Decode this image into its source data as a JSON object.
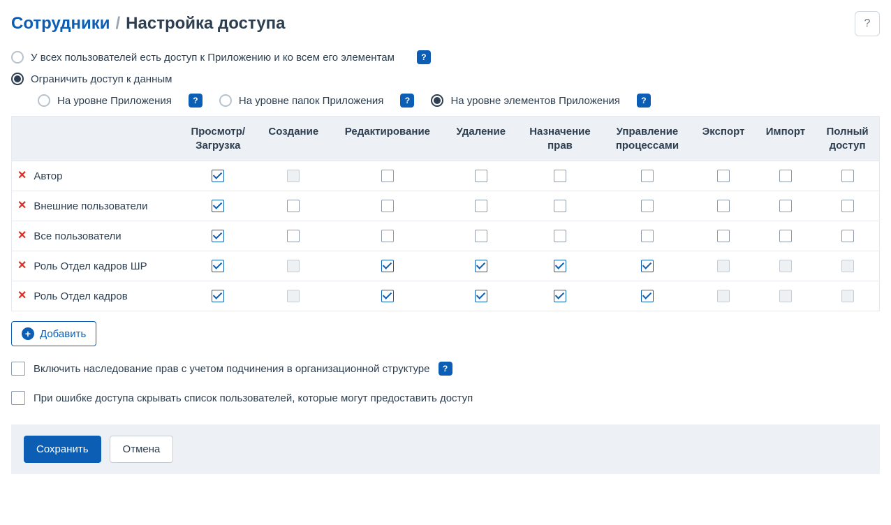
{
  "breadcrumb": {
    "parent": "Сотрудники",
    "separator": "/",
    "current": "Настройка доступа"
  },
  "help_glyph": "?",
  "access_mode": {
    "all_users": {
      "label": "У всех пользователей есть доступ к Приложению и ко всем его элементам",
      "selected": false
    },
    "restrict": {
      "label": "Ограничить доступ к данным",
      "selected": true
    }
  },
  "restrict_level": {
    "app": {
      "label": "На уровне Приложения",
      "selected": false
    },
    "folders": {
      "label": "На уровне папок Приложения",
      "selected": false
    },
    "elements": {
      "label": "На уровне элементов Приложения",
      "selected": true
    }
  },
  "columns": [
    "Просмотр/",
    "Загрузка",
    "Создание",
    "Редактирование",
    "Удаление",
    "Назначение",
    "прав",
    "Управление",
    "процессами",
    "Экспорт",
    "Импорт",
    "Полный",
    "доступ"
  ],
  "col_headers": {
    "view": {
      "l1": "Просмотр/",
      "l2": "Загрузка"
    },
    "create": {
      "l1": "Создание"
    },
    "edit": {
      "l1": "Редактирование"
    },
    "delete": {
      "l1": "Удаление"
    },
    "assign": {
      "l1": "Назначение",
      "l2": "прав"
    },
    "process": {
      "l1": "Управление",
      "l2": "процессами"
    },
    "export": {
      "l1": "Экспорт"
    },
    "import": {
      "l1": "Импорт"
    },
    "full": {
      "l1": "Полный",
      "l2": "доступ"
    }
  },
  "rows": [
    {
      "name": "Автор",
      "cells": [
        "checked",
        "disabled",
        "empty",
        "empty",
        "empty",
        "empty",
        "empty",
        "empty",
        "empty"
      ]
    },
    {
      "name": "Внешние пользователи",
      "cells": [
        "checked",
        "empty",
        "empty",
        "empty",
        "empty",
        "empty",
        "empty",
        "empty",
        "empty"
      ]
    },
    {
      "name": "Все пользователи",
      "cells": [
        "checked",
        "empty",
        "empty",
        "empty",
        "empty",
        "empty",
        "empty",
        "empty",
        "empty"
      ]
    },
    {
      "name": "Роль Отдел кадров ШР",
      "cells": [
        "checked",
        "disabled",
        "checked",
        "checked",
        "checked",
        "checked",
        "disabled",
        "disabled",
        "disabled"
      ]
    },
    {
      "name": "Роль Отдел кадров",
      "cells": [
        "checked",
        "disabled",
        "checked",
        "checked",
        "checked",
        "checked",
        "disabled",
        "disabled",
        "disabled"
      ]
    }
  ],
  "add_button": "Добавить",
  "options": {
    "inherit": "Включить наследование прав с учетом подчинения в организационной структуре",
    "hide_on_error": "При ошибке доступа скрывать список пользователей, которые могут предоставить доступ"
  },
  "footer": {
    "save": "Сохранить",
    "cancel": "Отмена"
  },
  "del_glyph": "✕",
  "plus_glyph": "+"
}
